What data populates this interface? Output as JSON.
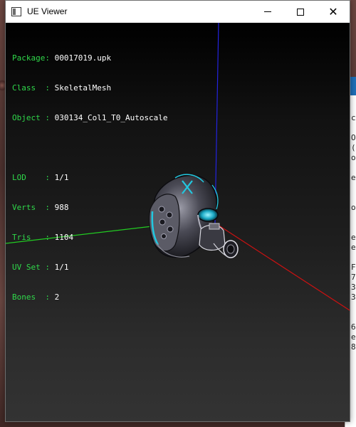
{
  "window": {
    "title": "UE Viewer",
    "controls": {
      "minimize": "minimize",
      "maximize": "maximize",
      "close": "close"
    }
  },
  "info": {
    "package_label": "Package:",
    "package_value": "00017019.upk",
    "class_label": "Class  :",
    "class_value": "SkeletalMesh",
    "object_label": "Object :",
    "object_value": "030134_Col1_T0_Autoscale",
    "lod_label": "LOD    :",
    "lod_value": "1/1",
    "verts_label": "Verts  :",
    "verts_value": "988",
    "tris_label": "Tris   :",
    "tris_value": "1104",
    "uvset_label": "UV Set :",
    "uvset_value": "1/1",
    "bones_label": "Bones  :",
    "bones_value": "2"
  },
  "colors": {
    "label_green": "#2fd84a",
    "axis_x": "#cc1111",
    "axis_y": "#22cc22",
    "axis_z": "#2222dd",
    "accent_cyan": "#22c8e0"
  },
  "background_window": {
    "text_lines": [
      "c",
      "",
      "O",
      "(",
      "o",
      "",
      "e",
      "",
      "",
      "o",
      "",
      "",
      "e",
      "e",
      "",
      "F",
      "7",
      "3",
      "3",
      "",
      "",
      "6",
      "e",
      "8"
    ]
  }
}
